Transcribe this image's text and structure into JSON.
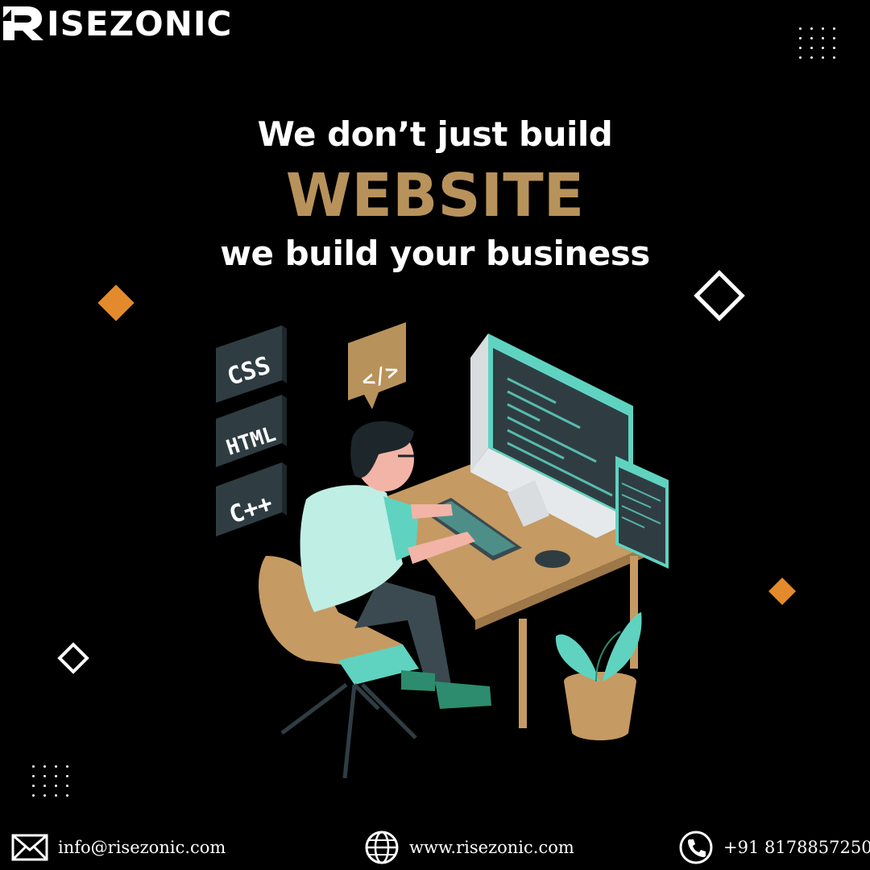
{
  "brand": {
    "name": "ISEZONIC",
    "logo_letter": "R"
  },
  "headline": {
    "line1": "We don’t just build",
    "line2": "WEBSITE",
    "line3": "we build your business"
  },
  "tags": {
    "css": "CSS",
    "html": "HTML",
    "cpp": "C++",
    "code": "</>"
  },
  "footer": {
    "email": "info@risezonic.com",
    "website": "www.risezonic.com",
    "phone": "+91 8178857250"
  },
  "colors": {
    "accent_gold": "#b8925b",
    "accent_orange": "#e38b2c",
    "teal": "#5fd3c0",
    "dark_slate": "#2f3d43",
    "background": "#000000"
  },
  "icons": [
    "mail-icon",
    "globe-icon",
    "phone-icon"
  ]
}
